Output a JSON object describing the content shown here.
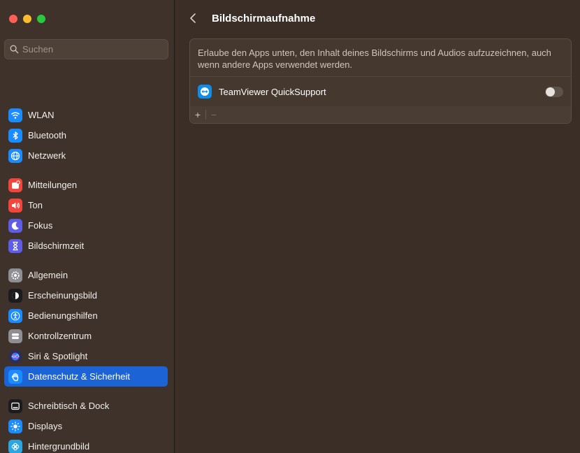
{
  "window": {
    "title": "Bildschirmaufnahme"
  },
  "sidebar": {
    "search_placeholder": "Suchen",
    "groups": [
      [
        {
          "label": "WLAN",
          "icon": "wifi-icon",
          "color": "#1a8cff"
        },
        {
          "label": "Bluetooth",
          "icon": "bluetooth-icon",
          "color": "#1a8cff"
        },
        {
          "label": "Netzwerk",
          "icon": "globe-icon",
          "color": "#1a8cff"
        }
      ],
      [
        {
          "label": "Mitteilungen",
          "icon": "bell-icon",
          "color": "#f2463d"
        },
        {
          "label": "Ton",
          "icon": "speaker-icon",
          "color": "#f2463d"
        },
        {
          "label": "Fokus",
          "icon": "moon-icon",
          "color": "#5f5ce6"
        },
        {
          "label": "Bildschirmzeit",
          "icon": "hourglass-icon",
          "color": "#5f5ce6"
        }
      ],
      [
        {
          "label": "Allgemein",
          "icon": "gear-icon",
          "color": "#8e8e93"
        },
        {
          "label": "Erscheinungsbild",
          "icon": "appearance-icon",
          "color": "#1c1c1e"
        },
        {
          "label": "Bedienungshilfen",
          "icon": "accessibility-icon",
          "color": "#1a8cff"
        },
        {
          "label": "Kontrollzentrum",
          "icon": "control-center-icon",
          "color": "#8e8e93"
        },
        {
          "label": "Siri & Spotlight",
          "icon": "siri-icon",
          "color": "#2d2d55"
        },
        {
          "label": "Datenschutz & Sicherheit",
          "icon": "hand-icon",
          "color": "#1a8cff",
          "active": true
        }
      ],
      [
        {
          "label": "Schreibtisch & Dock",
          "icon": "dock-icon",
          "color": "#1c1c1e"
        },
        {
          "label": "Displays",
          "icon": "sun-icon",
          "color": "#1a8cff"
        },
        {
          "label": "Hintergrundbild",
          "icon": "wallpaper-icon",
          "color": "#2aa7e0"
        }
      ]
    ]
  },
  "main": {
    "description": "Erlaube den Apps unten, den Inhalt deines Bildschirms und Audios aufzuzeichnen, auch wenn andere Apps verwendet werden.",
    "apps": [
      {
        "name": "TeamViewer QuickSupport",
        "enabled": false
      }
    ],
    "add_label": "+",
    "remove_label": "−"
  },
  "colors": {
    "accent": "#1c63d5",
    "background": "#3b2e26"
  }
}
